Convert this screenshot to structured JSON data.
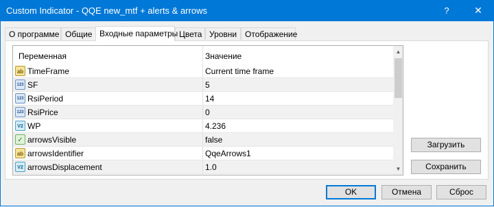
{
  "window": {
    "title": "Custom Indicator - QQE new_mtf + alerts & arrows",
    "help_label": "?",
    "close_label": "✕"
  },
  "tabs": [
    {
      "label": "О программе",
      "active": false
    },
    {
      "label": "Общие",
      "active": false
    },
    {
      "label": "Входные параметры",
      "active": true
    },
    {
      "label": "Цвета",
      "active": false
    },
    {
      "label": "Уровни",
      "active": false
    },
    {
      "label": "Отображение",
      "active": false
    }
  ],
  "grid": {
    "columns": {
      "name": "Переменная",
      "value": "Значение"
    },
    "rows": [
      {
        "icon": "ab",
        "type_icon": "string-type-icon",
        "name": "TimeFrame",
        "value": "Current time frame"
      },
      {
        "icon": "123",
        "type_icon": "integer-type-icon",
        "name": "SF",
        "value": "5"
      },
      {
        "icon": "123",
        "type_icon": "integer-type-icon",
        "name": "RsiPeriod",
        "value": "14"
      },
      {
        "icon": "123",
        "type_icon": "integer-type-icon",
        "name": "RsiPrice",
        "value": "0"
      },
      {
        "icon": "V2",
        "type_icon": "double-type-icon",
        "name": "WP",
        "value": "4.236"
      },
      {
        "icon": "bool",
        "type_icon": "bool-type-icon",
        "name": "arrowsVisible",
        "value": "false"
      },
      {
        "icon": "ab",
        "type_icon": "string-type-icon",
        "name": "arrowsIdentifier",
        "value": "QqeArrows1"
      },
      {
        "icon": "V2",
        "type_icon": "double-type-icon",
        "name": "arrowsDisplacement",
        "value": "1.0"
      }
    ]
  },
  "side_buttons": {
    "load": "Загрузить",
    "save": "Сохранить"
  },
  "footer_buttons": {
    "ok": "OK",
    "cancel": "Отмена",
    "reset": "Сброс"
  }
}
